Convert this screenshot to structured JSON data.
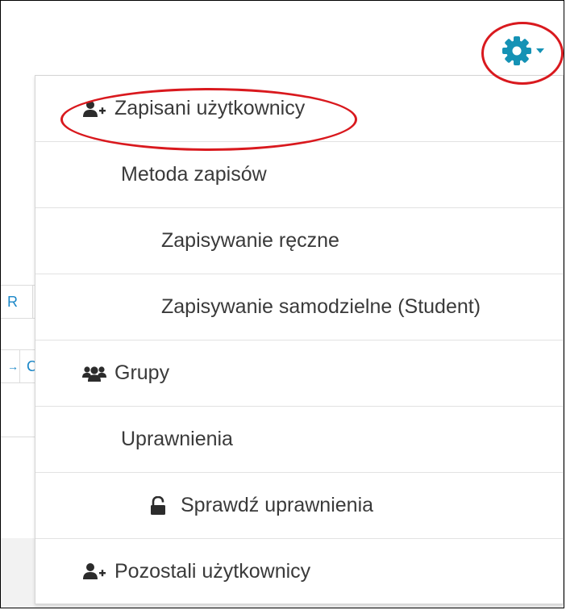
{
  "background": {
    "row1_cell": "R",
    "row2_cells": [
      "→",
      "C"
    ]
  },
  "settings": {
    "gear_icon": "gear-icon",
    "caret_icon": "caret-down-icon",
    "accent": "#1592b5",
    "annotation_color": "#d9191e"
  },
  "menu": {
    "items": [
      {
        "label": "Zapisani użytkownicy",
        "icon": "user-plus-icon"
      },
      {
        "label": "Metoda zapisów"
      },
      {
        "label": "Zapisywanie ręczne"
      },
      {
        "label": "Zapisywanie samodzielne (Student)"
      },
      {
        "label": "Grupy",
        "icon": "users-icon"
      },
      {
        "label": "Uprawnienia"
      },
      {
        "label": "Sprawdź uprawnienia",
        "icon": "unlock-icon"
      },
      {
        "label": "Pozostali użytkownicy",
        "icon": "user-plus-icon"
      }
    ]
  }
}
